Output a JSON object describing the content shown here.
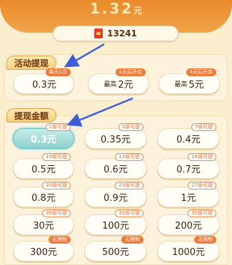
{
  "balance": {
    "amount": "1.32",
    "unit": "元"
  },
  "coins": "13241",
  "sections": {
    "activity_title": "活动提现",
    "amounts_title": "提现金额"
  },
  "activity": [
    {
      "amount": "0.3元",
      "prefix": "",
      "tag": "每天1次"
    },
    {
      "amount": "2元",
      "prefix": "最高",
      "tag": "1天后开启"
    },
    {
      "amount": "5元",
      "prefix": "最高",
      "tag": "4天后开启"
    }
  ],
  "amounts": [
    {
      "amount": "0.3元",
      "tag": "1级可提"
    },
    {
      "amount": "0.35元",
      "tag": "3级可提"
    },
    {
      "amount": "0.4元",
      "tag": "7级可提"
    },
    {
      "amount": "0.5元",
      "tag": "10级可提"
    },
    {
      "amount": "0.6元",
      "tag": "13级可提"
    },
    {
      "amount": "0.7元",
      "tag": "16级可提"
    },
    {
      "amount": "0.8元",
      "tag": "20级可提"
    },
    {
      "amount": "0.9元",
      "tag": "23级可提"
    },
    {
      "amount": "1元",
      "tag": "27级可提"
    },
    {
      "amount": "30元",
      "tag": "30级可提"
    },
    {
      "amount": "100元",
      "tag": "32级可提"
    },
    {
      "amount": "200元",
      "tag": "35级可提"
    },
    {
      "amount": "300元",
      "tag": "无限制"
    },
    {
      "amount": "500元",
      "tag": "无限制"
    },
    {
      "amount": "1000元",
      "tag": "无限制"
    }
  ],
  "colors": {
    "accent": "#f07a3a",
    "selected": "#8dd0cb",
    "arrow": "#3f5fd6"
  }
}
